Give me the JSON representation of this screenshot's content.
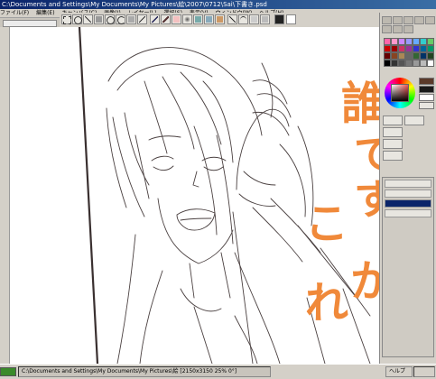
{
  "window": {
    "title": "C:\\Documents and Settings\\My Documents\\My Pictures\\絵\\2007\\0712\\Sai\\下書き.psd"
  },
  "menu": {
    "items": [
      "ファイル(F)",
      "編集(E)",
      "キャンバス(C)",
      "画像(I)",
      "レイヤー(L)",
      "選択(S)",
      "表示(V)",
      "ウィンドウ(W)",
      "ヘルプ(H)"
    ]
  },
  "annotation": {
    "chars": [
      "誰",
      "で",
      "す",
      "か",
      "こ",
      "れ"
    ]
  },
  "taskbar": {
    "tab_label": "C:\\Documents and Settings\\My Documents\\My Pictures\\絵 [2150x3150 25% 0°]",
    "help_label": "ヘルプ"
  },
  "colors": {
    "annotation": "#f0893a",
    "sketch_stroke": "#4a4040",
    "title_bar": "#0a246a",
    "chrome": "#d4d0c8"
  },
  "palette": [
    "#ff66aa",
    "#ff99cc",
    "#cc88ff",
    "#9999ff",
    "#66aaff",
    "#33cccc",
    "#66cc66",
    "#cc0000",
    "#990000",
    "#cc3366",
    "#993399",
    "#3333cc",
    "#006699",
    "#009966",
    "#660000",
    "#884422",
    "#aa8855",
    "#666666",
    "#336633",
    "#003366",
    "#224422",
    "#000000",
    "#333333",
    "#555555",
    "#777777",
    "#999999",
    "#bbbbbb",
    "#ffffff"
  ]
}
